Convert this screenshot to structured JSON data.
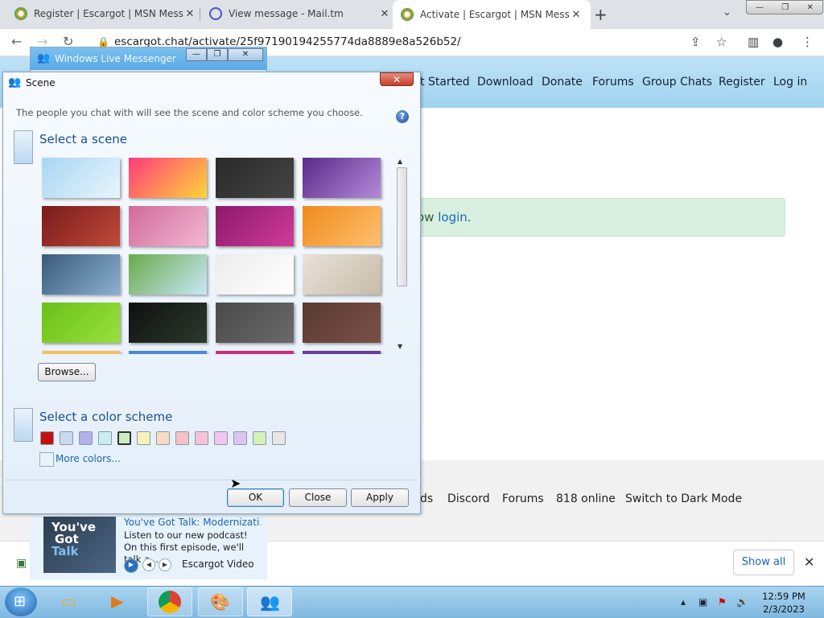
{
  "browser": {
    "tabs": [
      {
        "title": "Register | Escargot | MSN Messer",
        "active": false,
        "favicon_color": "#e8a22b"
      },
      {
        "title": "View message - Mail.tm",
        "active": false,
        "favicon_color": "#4a55c9"
      },
      {
        "title": "Activate | Escargot | MSN Messen",
        "active": true,
        "favicon_color": "#e8a22b"
      }
    ],
    "new_tab_icon": "plus-icon",
    "url": "escargot.chat/activate/25f97190194255774da8889e8a526b52/"
  },
  "site": {
    "nav": [
      "t Started",
      "Download",
      "Donate",
      "Forums",
      "Group Chats",
      "Register",
      "Log in"
    ],
    "alert_prefix": "ow ",
    "alert_link": "login",
    "alert_suffix": ".",
    "footer": [
      "ds",
      "Discord",
      "Forums",
      "818 online",
      "Switch to Dark Mode"
    ],
    "show_all": "Show all"
  },
  "messenger": {
    "title": "Windows Live Messenger",
    "promo_thumb": [
      "You've",
      "Got",
      "Talk"
    ],
    "promo_title": "You've Got Talk: Modernizati...",
    "promo_body": "Listen to our new podcast! On this first episode, we'll talk a...",
    "promo_source": "Escargot Video"
  },
  "scene_dialog": {
    "title": "Scene",
    "description": "The people you chat with will see the scene and color scheme you choose.",
    "help_icon": "help-icon",
    "select_scene": "Select a scene",
    "browse": "Browse...",
    "select_color": "Select a color scheme",
    "more_colors": "More colors...",
    "ok": "OK",
    "close": "Close",
    "apply": "Apply",
    "scenes": [
      [
        "#a9d6f2",
        "#e8f5fd"
      ],
      [
        "#ff3b7a",
        "#ffd43b"
      ],
      [
        "#2a2a2a",
        "#444444"
      ],
      [
        "#5a2a8a",
        "#b58ad8"
      ],
      [
        "#7a1a1a",
        "#c04a3a"
      ],
      [
        "#d06a9a",
        "#f3b8d0"
      ],
      [
        "#8a1a6a",
        "#d23a9a"
      ],
      [
        "#f08a1a",
        "#ffc070"
      ],
      [
        "#3a5a7a",
        "#8ab0d0"
      ],
      [
        "#6aaa4a",
        "#c8e8f8"
      ],
      [
        "#ececec",
        "#ffffff"
      ],
      [
        "#e8e2d8",
        "#c8bca8"
      ],
      [
        "#6ac01a",
        "#9ae03a"
      ],
      [
        "#101010",
        "#2c3a2c"
      ],
      [
        "#4a4a4a",
        "#6a6a6a"
      ],
      [
        "#5a3a32",
        "#7a5048"
      ]
    ],
    "colors": [
      "#c41010",
      "#c8dcef",
      "#b3b0ea",
      "#c6eef3",
      "#c8eec0",
      "#f6f2b8",
      "#f7dcc2",
      "#f4c2c2",
      "#f6c2da",
      "#f2c6ee",
      "#dcc6f0",
      "#d2f2b8",
      "#e6e6e6"
    ],
    "selected_color": 4
  },
  "taskbar": {
    "time": "12:59 PM",
    "date": "2/3/2023"
  }
}
